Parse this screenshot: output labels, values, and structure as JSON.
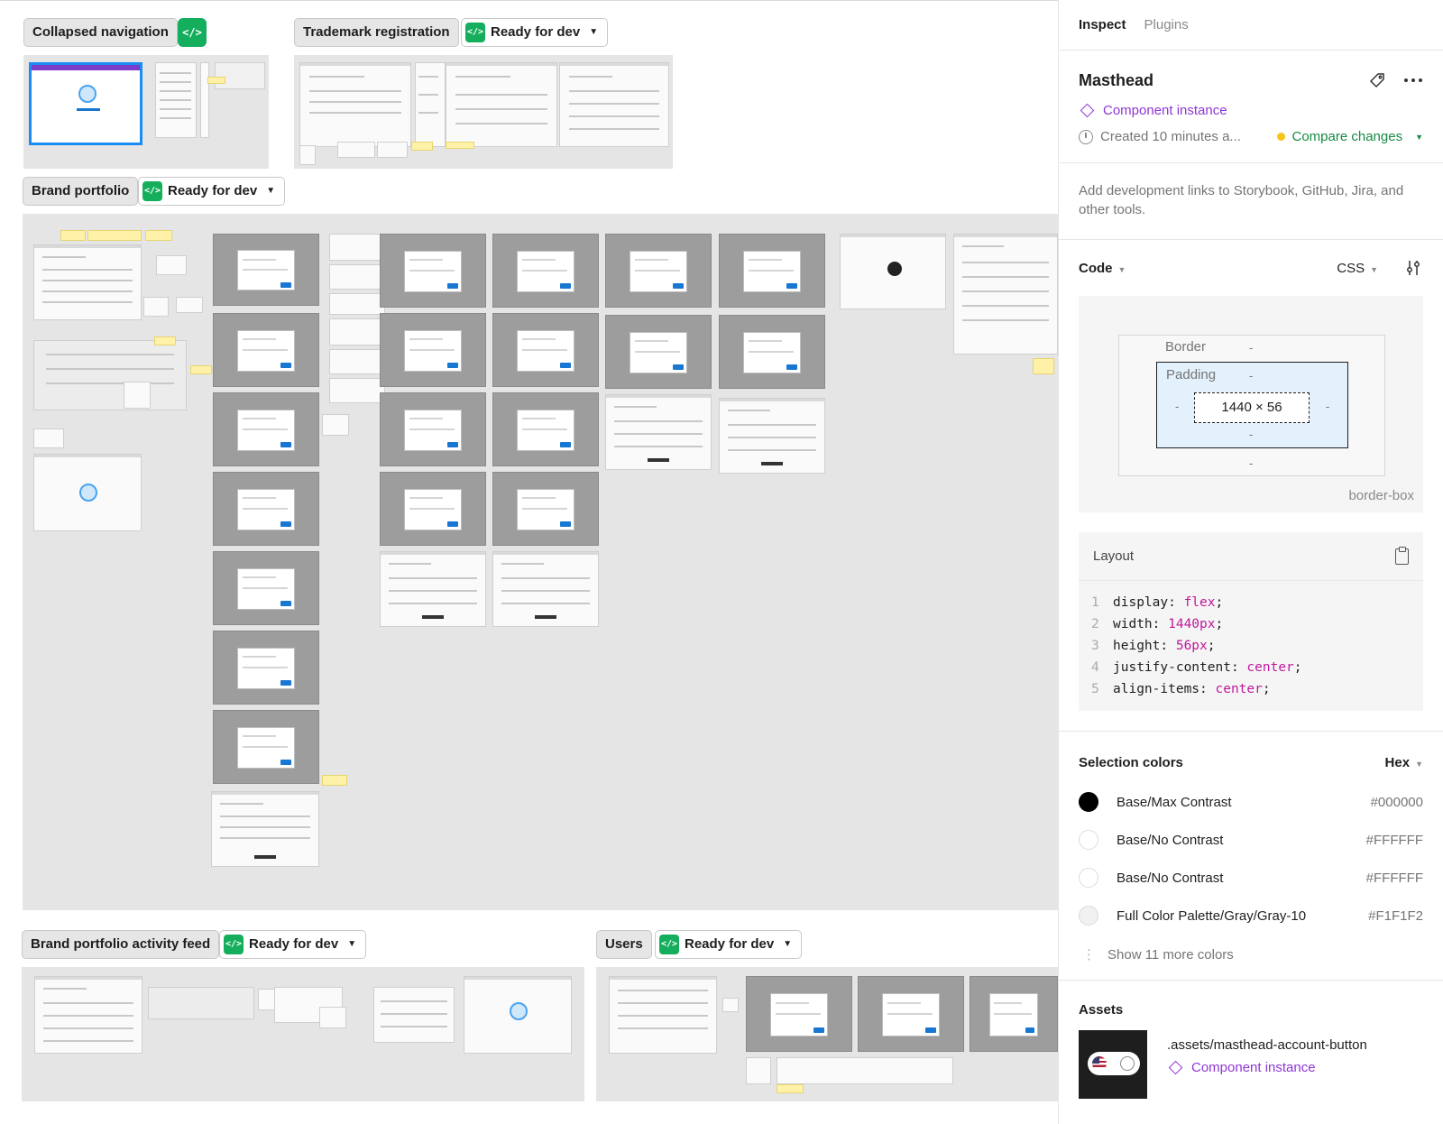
{
  "canvas": {
    "sections": [
      {
        "label": "Collapsed navigation",
        "status": ""
      },
      {
        "label": "Trademark registration",
        "status": "Ready for dev"
      },
      {
        "label": "Brand portfolio",
        "status": "Ready for dev"
      },
      {
        "label": "Brand portfolio activity feed",
        "status": "Ready for dev"
      },
      {
        "label": "Users",
        "status": "Ready for dev"
      }
    ],
    "code_badge_glyph": "</>"
  },
  "panel": {
    "tabs": [
      {
        "label": "Inspect",
        "active": true
      },
      {
        "label": "Plugins",
        "active": false
      }
    ],
    "selection": {
      "title": "Masthead",
      "component_label": "Component instance",
      "created": "Created 10 minutes a...",
      "compare_label": "Compare changes"
    },
    "dev_links": "Add development links to Storybook, GitHub, Jira, and other tools.",
    "code": {
      "title": "Code",
      "language": "CSS",
      "box_model": {
        "border_label": "Border",
        "padding_label": "Padding",
        "size": "1440 × 56",
        "dash": "-",
        "sizing": "border-box"
      },
      "layout_title": "Layout",
      "lines": [
        {
          "n": "1",
          "prop": "display: ",
          "val": "flex",
          "end": ";"
        },
        {
          "n": "2",
          "prop": "width: ",
          "val": "1440px",
          "end": ";"
        },
        {
          "n": "3",
          "prop": "height: ",
          "val": "56px",
          "end": ";"
        },
        {
          "n": "4",
          "prop": "justify-content: ",
          "val": "center",
          "end": ";"
        },
        {
          "n": "5",
          "prop": "align-items: ",
          "val": "center",
          "end": ";"
        }
      ]
    },
    "selection_colors": {
      "title": "Selection colors",
      "format": "Hex",
      "items": [
        {
          "name": "Base/Max Contrast",
          "hex": "#000000",
          "color": "#000000"
        },
        {
          "name": "Base/No Contrast",
          "hex": "#FFFFFF",
          "color": "#FFFFFF"
        },
        {
          "name": "Base/No Contrast",
          "hex": "#FFFFFF",
          "color": "#FFFFFF"
        },
        {
          "name": "Full Color Palette/Gray/Gray-10",
          "hex": "#F1F1F2",
          "color": "#F1F1F2"
        }
      ],
      "more": "Show 11 more colors"
    },
    "assets": {
      "title": "Assets",
      "items": [
        {
          "name": ".assets/masthead-account-button",
          "type": "Component instance"
        }
      ]
    }
  }
}
